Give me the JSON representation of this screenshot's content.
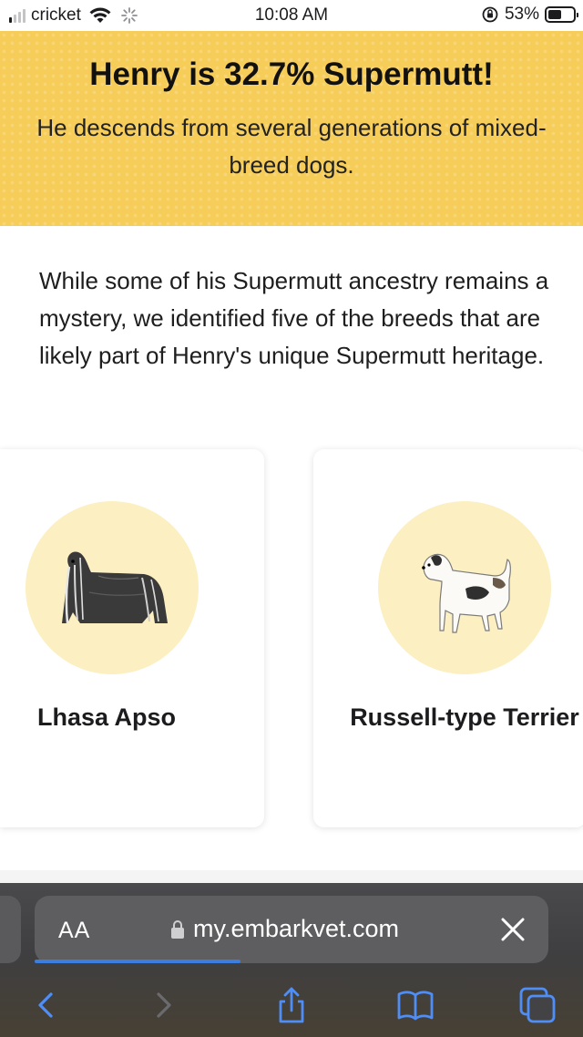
{
  "status_bar": {
    "carrier": "cricket",
    "time": "10:08 AM",
    "battery": "53%",
    "battery_level": 0.53,
    "signal_bars_active": 1,
    "signal_bars_total": 4
  },
  "banner": {
    "title": "Henry is 32.7% Supermutt!",
    "subtitle": "He descends from several generations of mixed-breed dogs."
  },
  "intro_text": "While some of his Supermutt ancestry remains a mystery, we identified five of the breeds that are likely part of Henry's unique Supermutt heritage.",
  "breeds": [
    {
      "name": "Lhasa Apso",
      "icon": "lhasa-apso-dog-illustration"
    },
    {
      "name": "Russell-type Terrier",
      "icon": "russell-terrier-dog-illustration"
    }
  ],
  "safari": {
    "text_size_label": "AA",
    "url": "my.embarkvet.com",
    "load_progress": 0.4,
    "toolbar": [
      "back-icon",
      "forward-icon",
      "share-icon",
      "bookmarks-icon",
      "tabs-icon"
    ]
  },
  "colors": {
    "banner_yellow": "#f7cd5a",
    "circle_yellow": "#fcefc1",
    "progress_blue": "#3b7ee0",
    "toolbar_icon_blue": "#4f8ef7"
  }
}
